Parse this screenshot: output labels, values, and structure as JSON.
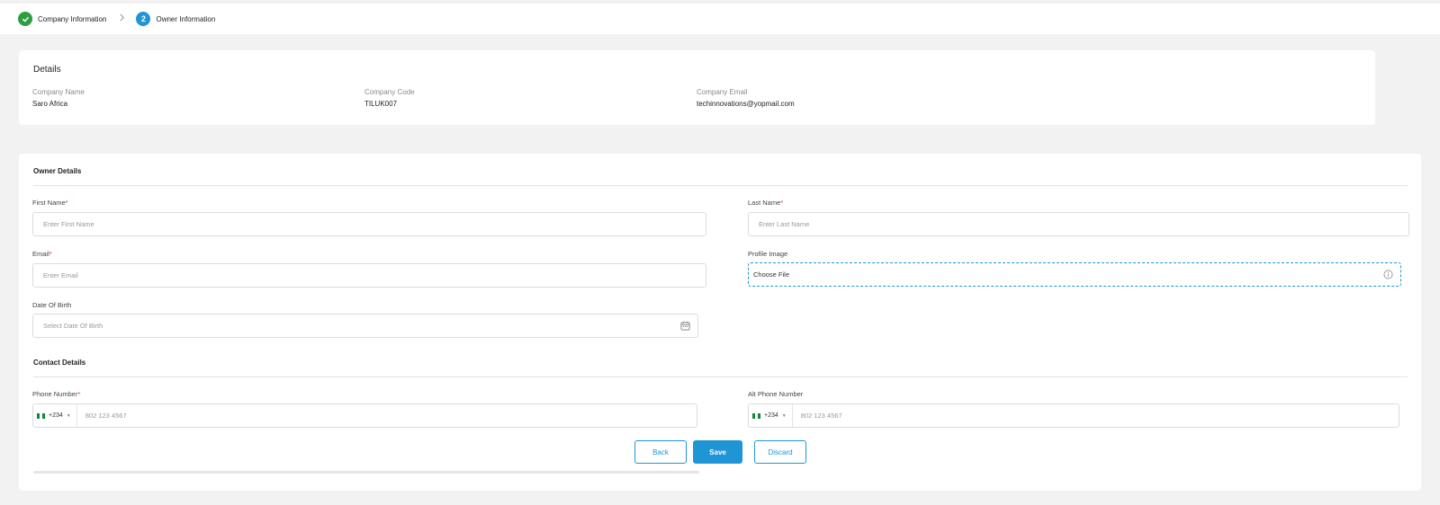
{
  "stepper": {
    "steps": [
      {
        "number": "",
        "label": "Company Information",
        "status": "done"
      },
      {
        "number": "2",
        "label": "Owner Information",
        "status": "active"
      }
    ]
  },
  "details": {
    "title": "Details",
    "fields": [
      {
        "label": "Company Name",
        "value": "Saro Africa"
      },
      {
        "label": "Company Code",
        "value": "TILUK007"
      },
      {
        "label": "Company Email",
        "value": "techinnovations@yopmail.com"
      }
    ]
  },
  "owner": {
    "title": "Owner Details",
    "first_name": {
      "label": "First Name",
      "required": "*",
      "placeholder": "Enter First Name"
    },
    "last_name": {
      "label": "Last Name",
      "required": "*",
      "placeholder": "Enter Last Name"
    },
    "email": {
      "label": "Email",
      "required": "*",
      "placeholder": "Enter Email"
    },
    "profile_image": {
      "label": "Profile Image",
      "value": "Choose File"
    },
    "dob": {
      "label": "Date Of Birth",
      "placeholder": "Select Date Of Birth"
    }
  },
  "contact": {
    "title": "Contact Details",
    "phone": {
      "label": "Phone Number",
      "required": "*",
      "code": "+234",
      "placeholder": "802 123 4567"
    },
    "alt_phone": {
      "label": "Alt Phone Number",
      "code": "+234",
      "placeholder": "802 123 4567"
    }
  },
  "actions": {
    "back": "Back",
    "save": "Save",
    "discard": "Discard"
  },
  "colors": {
    "accent": "#1f95d6",
    "success": "#2e9e3e",
    "required": "#e53935"
  }
}
